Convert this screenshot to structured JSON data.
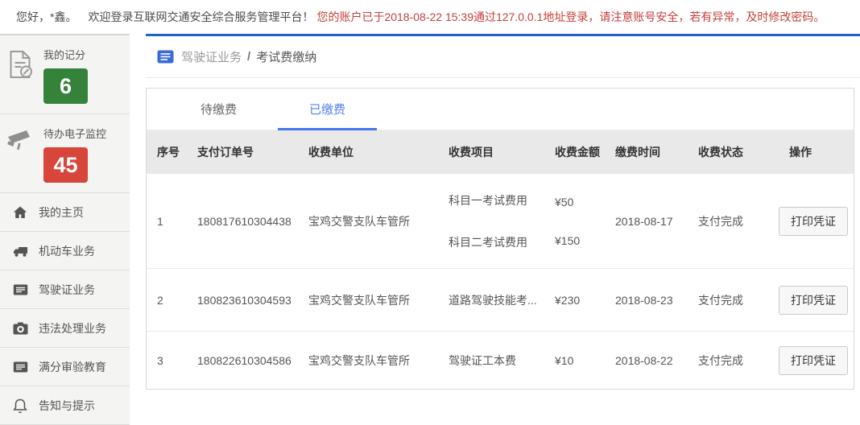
{
  "topbar": {
    "greeting": "您好，*鑫。",
    "welcome": "欢迎登录互联网交通安全综合服务管理平台！",
    "alert": "您的账户已于2018-08-22 15:39通过127.0.0.1地址登录，请注意账号安全，若有异常，及时修改密码。"
  },
  "sidebar": {
    "stats": [
      {
        "label": "我的记分",
        "value": "6",
        "icon": "score-document-icon",
        "color": "#35823b"
      },
      {
        "label": "待办电子监控",
        "value": "45",
        "icon": "cctv-camera-icon",
        "color": "#d8453a"
      }
    ],
    "menu": [
      {
        "label": "我的主页",
        "icon": "home-icon"
      },
      {
        "label": "机动车业务",
        "icon": "truck-icon"
      },
      {
        "label": "驾驶证业务",
        "icon": "license-card-icon"
      },
      {
        "label": "违法处理业务",
        "icon": "camera-icon"
      },
      {
        "label": "满分审验教育",
        "icon": "list-icon"
      },
      {
        "label": "告知与提示",
        "icon": "bell-icon"
      }
    ]
  },
  "breadcrumb": {
    "section": "驾驶证业务",
    "separator": "/",
    "page": "考试费缴纳"
  },
  "tabs": [
    {
      "label": "待缴费",
      "active": false
    },
    {
      "label": "已缴费",
      "active": true
    }
  ],
  "table": {
    "headers": [
      "序号",
      "支付订单号",
      "收费单位",
      "收费项目",
      "收费金额",
      "缴费时间",
      "收费状态",
      "操作"
    ],
    "rows": [
      {
        "index": "1",
        "order_no": "180817610304438",
        "unit": "宝鸡交警支队车管所",
        "items": [
          {
            "name": "科目一考试费用",
            "amount": "¥50"
          },
          {
            "name": "科目二考试费用",
            "amount": "¥150"
          }
        ],
        "pay_date": "2018-08-17",
        "status": "支付完成",
        "action": "打印凭证"
      },
      {
        "index": "2",
        "order_no": "180823610304593",
        "unit": "宝鸡交警支队车管所",
        "items": [
          {
            "name": "道路驾驶技能考...",
            "amount": "¥230"
          }
        ],
        "pay_date": "2018-08-23",
        "status": "支付完成",
        "action": "打印凭证"
      },
      {
        "index": "3",
        "order_no": "180822610304586",
        "unit": "宝鸡交警支队车管所",
        "items": [
          {
            "name": "驾驶证工本费",
            "amount": "¥10"
          }
        ],
        "pay_date": "2018-08-22",
        "status": "支付完成",
        "action": "打印凭证"
      }
    ]
  },
  "colors": {
    "accent_blue_border": "#2062c6",
    "tab_active_blue": "#5380f0",
    "breadcrumb_icon_blue": "#3a6bd8",
    "badge_green": "#35823b",
    "badge_red": "#d8453a",
    "alert_red": "#c5403b",
    "sidebar_bg": "#f4f4f2",
    "table_header_bg": "#e9e9e9"
  }
}
